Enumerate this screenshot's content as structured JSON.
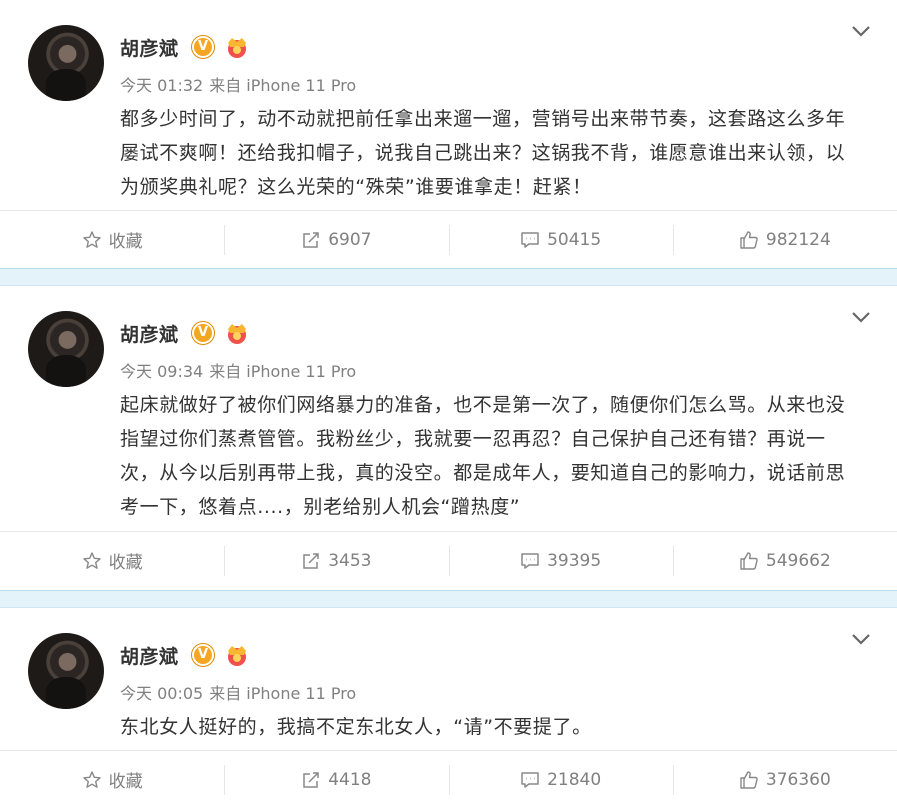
{
  "posts": [
    {
      "author": "胡彦斌",
      "badge": "V",
      "time": "今天 01:32",
      "source": "来自 iPhone 11 Pro",
      "text": "都多少时间了，动不动就把前任拿出来遛一遛，营销号出来带节奏，这套路这么多年屡试不爽啊！还给我扣帽子，说我自己跳出来？这锅我不背，谁愿意谁出来认领，以为颁奖典礼呢？这么光荣的“殊荣”谁要谁拿走！赶紧！",
      "actions": {
        "favorite": "收藏",
        "repost": "6907",
        "comment": "50415",
        "like": "982124"
      }
    },
    {
      "author": "胡彦斌",
      "badge": "V",
      "time": "今天 09:34",
      "source": "来自 iPhone 11 Pro",
      "text": "起床就做好了被你们网络暴力的准备，也不是第一次了，随便你们怎么骂。从来也没指望过你们蒸煮管管。我粉丝少，我就要一忍再忍？自己保护自己还有错？再说一次，从今以后别再带上我，真的没空。都是成年人，要知道自己的影响力，说话前思考一下，悠着点....，别老给别人机会“蹭热度”",
      "actions": {
        "favorite": "收藏",
        "repost": "3453",
        "comment": "39395",
        "like": "549662"
      }
    },
    {
      "author": "胡彦斌",
      "badge": "V",
      "time": "今天 00:05",
      "source": "来自 iPhone 11 Pro",
      "text": "东北女人挺好的，我搞不定东北女人，“请”不要提了。",
      "actions": {
        "favorite": "收藏",
        "repost": "4418",
        "comment": "21840",
        "like": "376360"
      }
    }
  ],
  "colors": {
    "accent": "#f5a623",
    "separator": "#e4f2f9",
    "muted": "#808080",
    "text": "#333333"
  },
  "icons": {
    "favorite": "star-icon",
    "repost": "share-icon",
    "comment": "comment-icon",
    "like": "thumbs-up-icon",
    "menu": "chevron-down-icon",
    "badge": "verified-v-icon",
    "crown": "crown-icon"
  }
}
